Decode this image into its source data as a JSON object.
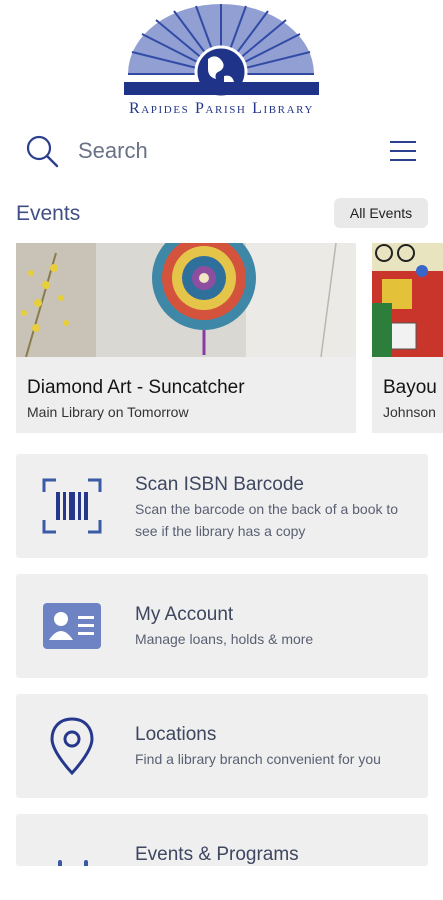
{
  "logo": {
    "text": "Rapides Parish Library"
  },
  "search": {
    "placeholder": "Search"
  },
  "events": {
    "title": "Events",
    "all_label": "All Events",
    "cards": [
      {
        "title": "Diamond Art - Suncatcher",
        "subtitle": "Main Library on Tomorrow"
      },
      {
        "title": "Bayou",
        "subtitle": "Johnson"
      }
    ]
  },
  "tiles": [
    {
      "title": "Scan ISBN Barcode",
      "subtitle": "Scan the barcode on the back of a book to see if the library has a copy"
    },
    {
      "title": "My Account",
      "subtitle": "Manage loans, holds & more"
    },
    {
      "title": "Locations",
      "subtitle": "Find a library branch convenient for you"
    },
    {
      "title": "Events & Programs",
      "subtitle": ""
    }
  ],
  "colors": {
    "brand": "#24378a",
    "tile_bg": "#efefef",
    "accent_blue": "#3b5aa6"
  }
}
